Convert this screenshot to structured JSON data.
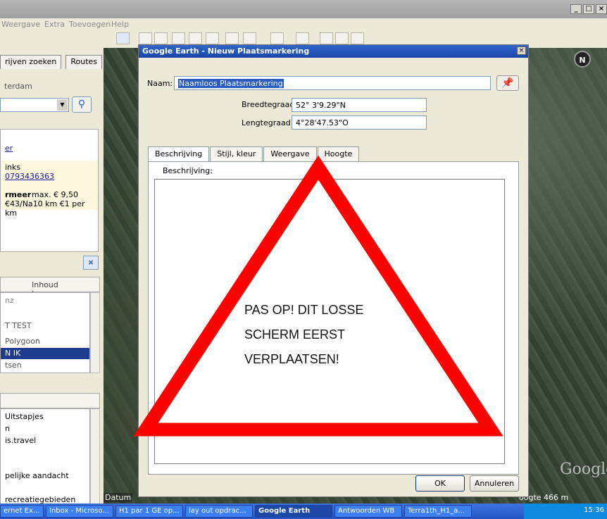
{
  "menu": [
    "Weergave",
    "Extra",
    "Toevoegen",
    "Help"
  ],
  "window_controls": [
    "_",
    "□",
    "×"
  ],
  "left_panel": {
    "tab_search": "rijven zoeken",
    "tab_routes": "Routes",
    "search_text": "terdam",
    "result_link": "er",
    "result_name": "inks",
    "result_phone": "0793436363",
    "result_title": "rmeer",
    "result_price": "max. € 9,50",
    "result_extra": "€43/Na10 km €1 per km",
    "places_close": "×",
    "add_content": "Inhoud toevoegen",
    "places": [
      "nz",
      "T TEST",
      "Polygoon",
      "N IK",
      "tsen"
    ],
    "layers": [
      "Uitstapjes",
      "n",
      "is.travel",
      "",
      "pelijke aandacht",
      "recreatiegebieden"
    ]
  },
  "map": {
    "north": "N",
    "logo": "Google",
    "eye_alt": "oogte   466 m",
    "datum": "Datum"
  },
  "dialog": {
    "title": "Google Earth - Nieuw Plaatsmarkering",
    "close": "×",
    "name_label": "Naam:",
    "name_value": "Naamloos Plaatsmarkering",
    "lat_label": "Breedtegraad:",
    "lat_value": "52° 3'9.29\"N",
    "lon_label": "Lengtegraad:",
    "lon_value": "4°28'47.53\"O",
    "tabs": [
      "Beschrijving",
      "Stijl, kleur",
      "Weergave",
      "Hoogte"
    ],
    "desc_label": "Beschrijving:",
    "ok": "OK",
    "cancel": "Annuleren"
  },
  "warning": {
    "line1": "PAS OP! DIT LOSSE",
    "line2": "SCHERM EERST",
    "line3": "VERPLAATSEN!",
    "color": "#ff0000"
  },
  "taskbar": {
    "items": [
      "ernet Ex...",
      "Inbox - Microso...",
      "H1 par 1 GE op...",
      "lay out opdrac...",
      "Google Earth",
      "Antwoorden WB",
      "Terra1th_H1_a..."
    ],
    "time": "15:36"
  }
}
